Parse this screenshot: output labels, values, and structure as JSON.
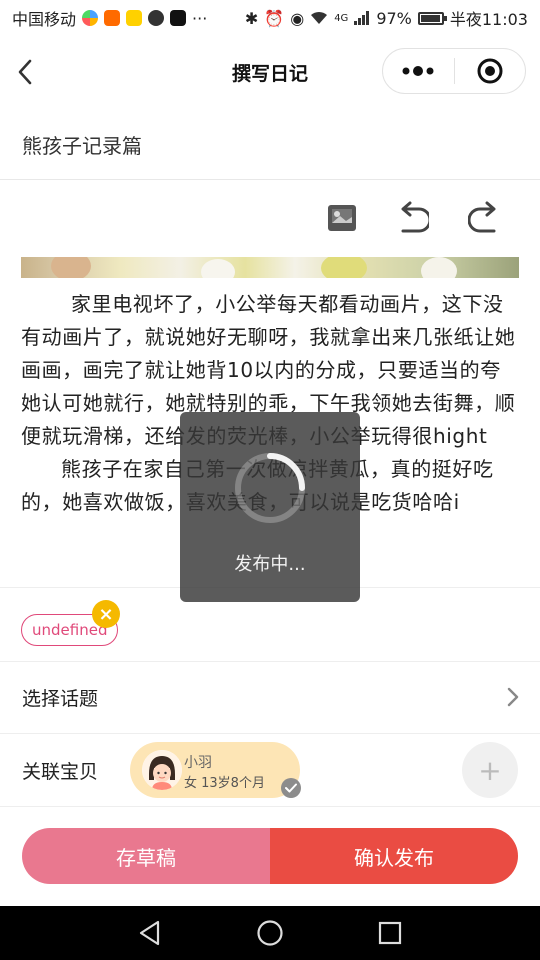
{
  "status_bar": {
    "carrier": "中国移动",
    "network": "4G",
    "battery_text": "97%",
    "battery_level": 0.97,
    "time": "半夜11:03",
    "app_icons": [
      "shop-icon",
      "taobao-icon",
      "meituan-icon",
      "message-icon",
      "tiktok-icon",
      "more-icon"
    ]
  },
  "nav": {
    "title": "撰写日记",
    "more_icon": "more-dots-icon",
    "close_icon": "target-close-icon"
  },
  "diary": {
    "title": "熊孩子记录篇",
    "paragraphs": [
      "家里电视坏了，小公举每天都看动画片，这下没有动画片了，就说她好无聊呀，我就拿出来几张纸让她画画，画完了就让她背10以内的分成，只要适当的夸她认可她就行，她就特别的乖，下午我领她去街舞，顺便就玩滑梯，还给发的荧光棒，小公举玩得很hight",
      "熊孩子在家自己第一次做凉拌黄瓜，真的挺好吃的，她喜欢做饭，喜欢美食，可以说是吃货哈哈i"
    ]
  },
  "toolbar": {
    "icons": [
      "image-icon",
      "undo-icon",
      "redo-icon"
    ]
  },
  "tags": [
    "undefined"
  ],
  "topic": {
    "label": "选择话题"
  },
  "baby": {
    "label": "关联宝贝",
    "name": "小羽",
    "info": "女  13岁8个月"
  },
  "actions": {
    "draft": "存草稿",
    "publish": "确认发布"
  },
  "loading": {
    "text": "发布中..."
  },
  "colors": {
    "accent_pink": "#e0497a",
    "draft_bg": "#e9788f",
    "publish_bg": "#ea4c43",
    "tag_close_bg": "#f5b900",
    "baby_card_bg": "#fde5b5"
  }
}
